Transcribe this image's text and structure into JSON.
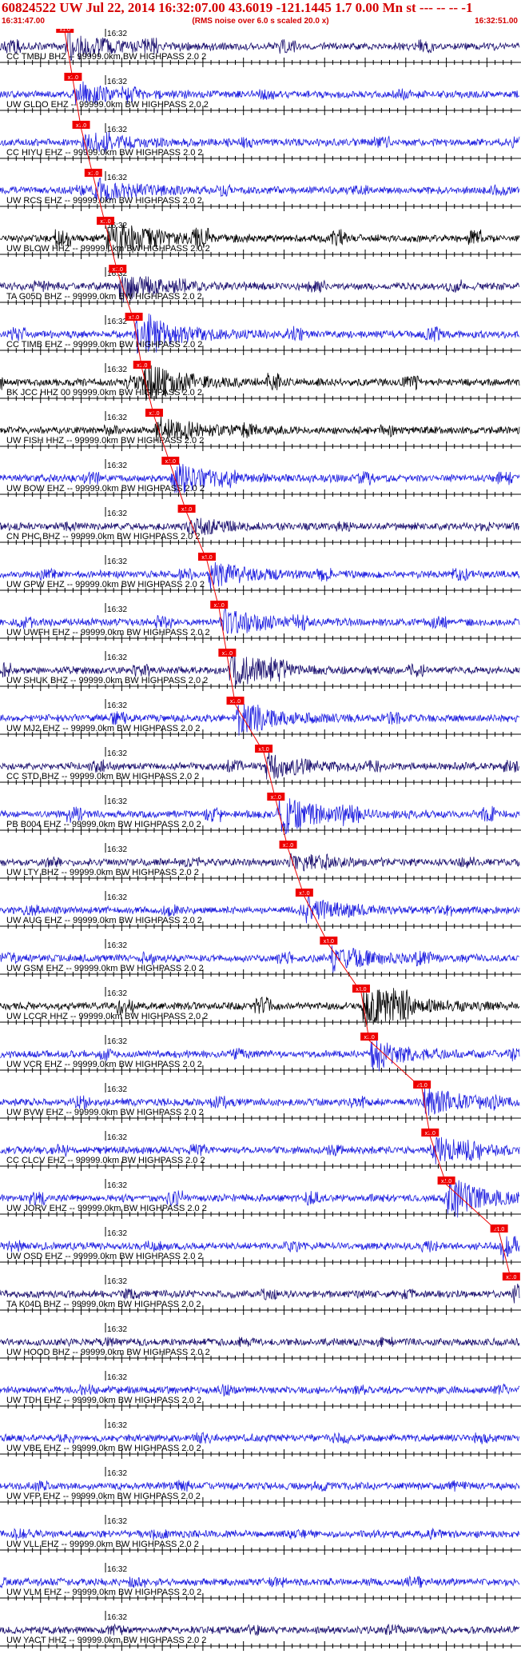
{
  "header": {
    "title": "60824522 UW Jul 22, 2014 16:32:07.00   43.6019 -121.1445  1.7 0.00 Mn st --- -- --   -1",
    "subtitle": "(RMS noise over 6.0 s scaled 20.0 x)",
    "start_time": "16:31:47.00",
    "end_time": "16:32:51.00"
  },
  "chart_data": {
    "type": "line",
    "title": "60824522 UW Jul 22, 2014 16:32:07.00   43.6019 -121.1445  1.7 0.00 Mn st --- -- --   -1",
    "xlabel": "",
    "ylabel": "",
    "x_range_seconds": [
      0,
      64
    ],
    "minute_tick_label": "16:32",
    "minute_tick_offset_s": 13,
    "pick_label": "x1.0",
    "colors": {
      "black": "#000000",
      "blue": "#1f1fe0",
      "navy": "#1a0f6e",
      "pick": "#ee0000",
      "axis": "#000000"
    },
    "traces": [
      {
        "label": "CC TMBU BHZ -- 99999.0km BW  HIGHPASS  2.0  2",
        "color": "navy",
        "amp": 0.5,
        "pick_s": 8.0,
        "seed": 1
      },
      {
        "label": "UW GLDO EHZ -- 99999.0km BW  HIGHPASS  2.0  2",
        "color": "blue",
        "amp": 0.35,
        "pick_s": 9.0,
        "seed": 2
      },
      {
        "label": "CC HIYU EHZ -- 99999.0km BW  HIGHPASS  2.0  2",
        "color": "blue",
        "amp": 0.3,
        "pick_s": 10.0,
        "seed": 3
      },
      {
        "label": "UW RCS EHZ -- 99999.0km BW  HIGHPASS  2.0  2",
        "color": "blue",
        "amp": 0.35,
        "pick_s": 11.5,
        "seed": 4
      },
      {
        "label": "UW BLOW HHZ -- 99999.0km BW  HIGHPASS  2.0  2",
        "color": "black",
        "amp": 0.75,
        "pick_s": 13.0,
        "seed": 5
      },
      {
        "label": "TA G05D BHZ -- 99999.0km BW  HIGHPASS  2.0  2",
        "color": "navy",
        "amp": 0.45,
        "pick_s": 14.5,
        "seed": 6
      },
      {
        "label": "CC TIMB EHZ -- 99999.0km BW  HIGHPASS  2.0  2",
        "color": "blue",
        "amp": 0.6,
        "pick_s": 16.5,
        "seed": 7
      },
      {
        "label": "BK JCC HHZ 00 99999.0km BW  HIGHPASS  2.0  2",
        "color": "black",
        "amp": 0.65,
        "pick_s": 17.5,
        "seed": 8
      },
      {
        "label": "UW FISH HHZ -- 99999.0km BW  HIGHPASS  2.0  2",
        "color": "black",
        "amp": 0.4,
        "pick_s": 19.0,
        "seed": 9
      },
      {
        "label": "UW BOW EHZ -- 99999.0km BW  HIGHPASS  2.0  2",
        "color": "blue",
        "amp": 0.5,
        "pick_s": 21.0,
        "seed": 10
      },
      {
        "label": "CN PHC BHZ -- 99999.0km BW  HIGHPASS  2.0  2",
        "color": "navy",
        "amp": 0.2,
        "pick_s": 23.0,
        "seed": 11
      },
      {
        "label": "UW GPW EHZ -- 99999.0km BW  HIGHPASS  2.0  2",
        "color": "blue",
        "amp": 0.4,
        "pick_s": 25.5,
        "seed": 12
      },
      {
        "label": "UW UWFH EHZ -- 99999.0km BW  HIGHPASS  2.0  2",
        "color": "blue",
        "amp": 0.45,
        "pick_s": 27.0,
        "seed": 13
      },
      {
        "label": "UW SHUK BHZ -- 99999.0km BW  HIGHPASS  2.0  2",
        "color": "navy",
        "amp": 0.55,
        "pick_s": 28.0,
        "seed": 14
      },
      {
        "label": "UW MJ2 EHZ -- 99999.0km BW  HIGHPASS  2.0  2",
        "color": "blue",
        "amp": 0.45,
        "pick_s": 29.0,
        "seed": 15
      },
      {
        "label": "CC STD BHZ -- 99999.0km BW  HIGHPASS  2.0  2",
        "color": "navy",
        "amp": 0.4,
        "pick_s": 32.5,
        "seed": 16
      },
      {
        "label": "PB B004 EHZ -- 99999.0km BW  HIGHPASS  2.0  2",
        "color": "blue",
        "amp": 0.65,
        "pick_s": 34.0,
        "seed": 17
      },
      {
        "label": "UW LTY BHZ -- 99999.0km BW  HIGHPASS  2.0  2",
        "color": "navy",
        "amp": 0.25,
        "pick_s": 35.5,
        "seed": 18
      },
      {
        "label": "UW AUG EHZ -- 99999.0km BW  HIGHPASS  2.0  2",
        "color": "blue",
        "amp": 0.35,
        "pick_s": 37.5,
        "seed": 19
      },
      {
        "label": "UW GSM EHZ -- 99999.0km BW  HIGHPASS  2.0  2",
        "color": "blue",
        "amp": 0.4,
        "pick_s": 40.5,
        "seed": 20
      },
      {
        "label": "UW LCCR HHZ -- 99999.0km BW  HIGHPASS  2.0  2",
        "color": "black",
        "amp": 0.8,
        "pick_s": 44.5,
        "seed": 21
      },
      {
        "label": "UW VCR EHZ -- 99999.0km BW  HIGHPASS  2.0  2",
        "color": "blue",
        "amp": 0.4,
        "pick_s": 45.5,
        "seed": 22
      },
      {
        "label": "UW BVW EHZ -- 99999.0km BW  HIGHPASS  2.0  2",
        "color": "blue",
        "amp": 0.45,
        "pick_s": 52.0,
        "seed": 23
      },
      {
        "label": "CC CLCV EHZ -- 99999.0km BW  HIGHPASS  2.0  2",
        "color": "blue",
        "amp": 0.4,
        "pick_s": 53.0,
        "seed": 24
      },
      {
        "label": "UW JORV EHZ -- 99999.0km BW  HIGHPASS  2.0  2",
        "color": "blue",
        "amp": 0.6,
        "pick_s": 55.0,
        "seed": 25
      },
      {
        "label": "UW OSD EHZ -- 99999.0km BW  HIGHPASS  2.0  2",
        "color": "blue",
        "amp": 0.35,
        "pick_s": 61.5,
        "seed": 26
      },
      {
        "label": "TA K04D BHZ -- 99999.0km BW  HIGHPASS  2.0  2",
        "color": "navy",
        "amp": 0.3,
        "pick_s": 63.0,
        "seed": 27
      },
      {
        "label": "UW HOOD BHZ -- 99999.0km BW  HIGHPASS  2.0  2",
        "color": "navy",
        "amp": 0.25,
        "pick_s": null,
        "seed": 28
      },
      {
        "label": "UW TDH EHZ -- 99999.0km BW  HIGHPASS  2.0  2",
        "color": "blue",
        "amp": 0.3,
        "pick_s": null,
        "seed": 29
      },
      {
        "label": "UW VBE EHZ -- 99999.0km BW  HIGHPASS  2.0  2",
        "color": "blue",
        "amp": 0.3,
        "pick_s": null,
        "seed": 30
      },
      {
        "label": "UW VFP EHZ -- 99999.0km BW  HIGHPASS  2.0  2",
        "color": "blue",
        "amp": 0.3,
        "pick_s": null,
        "seed": 31
      },
      {
        "label": "UW VLL EHZ -- 99999.0km BW  HIGHPASS  2.0  2",
        "color": "blue",
        "amp": 0.3,
        "pick_s": null,
        "seed": 32
      },
      {
        "label": "UW VLM EHZ -- 99999.0km BW  HIGHPASS  2.0  2",
        "color": "blue",
        "amp": 0.35,
        "pick_s": null,
        "seed": 33
      },
      {
        "label": "UW YACT HHZ -- 99999.0km BW  HIGHPASS  2.0  2",
        "color": "navy",
        "amp": 0.3,
        "pick_s": null,
        "seed": 34
      }
    ]
  }
}
